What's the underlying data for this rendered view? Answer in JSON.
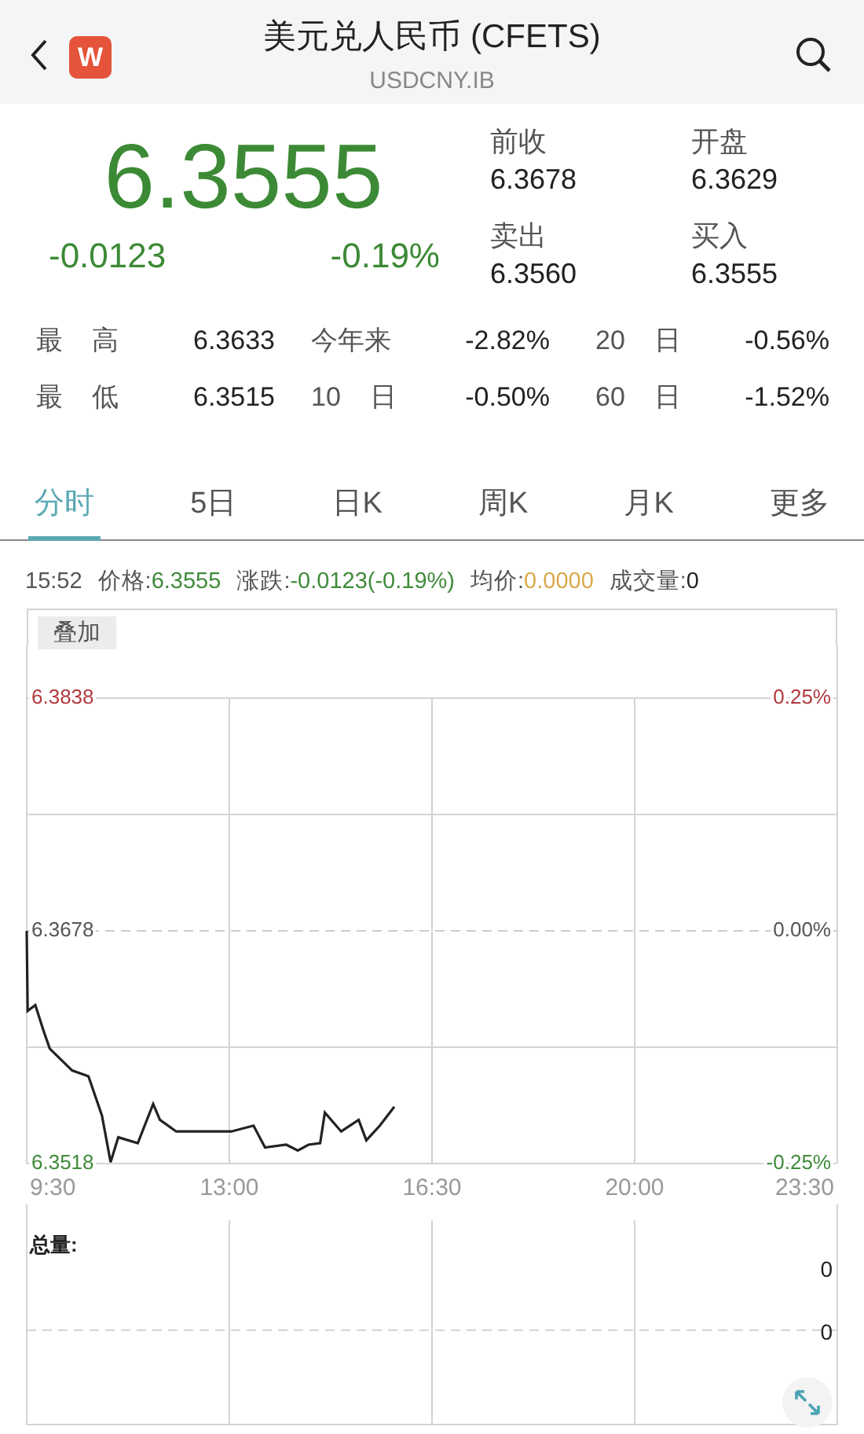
{
  "header": {
    "title": "美元兑人民币 (CFETS)",
    "subtitle": "USDCNY.IB",
    "logo_letter": "W"
  },
  "quote": {
    "price": "6.3555",
    "change": "-0.0123",
    "change_pct": "-0.19%",
    "fields": [
      {
        "label": "前收",
        "value": "6.3678"
      },
      {
        "label": "开盘",
        "value": "6.3629"
      },
      {
        "label": "卖出",
        "value": "6.3560"
      },
      {
        "label": "买入",
        "value": "6.3555"
      }
    ]
  },
  "stats": [
    [
      {
        "label": "最 高",
        "value": "6.3633"
      },
      {
        "label": "今年来",
        "value": "-2.82%"
      },
      {
        "label": "20 日",
        "value": "-0.56%"
      }
    ],
    [
      {
        "label": "最 低",
        "value": "6.3515"
      },
      {
        "label": "10 日",
        "value": "-0.50%"
      },
      {
        "label": "60 日",
        "value": "-1.52%"
      }
    ]
  ],
  "tabs": [
    {
      "label": "分时",
      "selected": true
    },
    {
      "label": "5日",
      "selected": false
    },
    {
      "label": "日K",
      "selected": false
    },
    {
      "label": "周K",
      "selected": false
    },
    {
      "label": "月K",
      "selected": false
    },
    {
      "label": "更多",
      "selected": false
    }
  ],
  "info": {
    "time": "15:52",
    "items": [
      {
        "label": "价格:",
        "value": "6.3555",
        "color": "#3f8b3a"
      },
      {
        "label": "涨跌:",
        "value": "-0.0123(-0.19%)",
        "color": "#3f8b3a"
      },
      {
        "label": "均价:",
        "value": "0.0000",
        "color": "#d9a84a"
      },
      {
        "label": "成交量:",
        "value": "0",
        "color": "#222222"
      }
    ]
  },
  "overlay_button": "叠加",
  "price_chart": {
    "chart_data": {
      "type": "line",
      "grid": true,
      "ref_lines": [
        {
          "axis": "y",
          "value": 6.3678
        }
      ],
      "xlim": [
        9.5,
        23.5
      ],
      "ylim": [
        6.3518,
        6.3838
      ],
      "xticks": [
        {
          "value": 9.5,
          "label": "9:30"
        },
        {
          "value": 13,
          "label": "13:00"
        },
        {
          "value": 16.5,
          "label": "16:30"
        },
        {
          "value": 20,
          "label": "20:00"
        },
        {
          "value": 23.5,
          "label": "23:30"
        }
      ],
      "yticks": [
        {
          "value": 6.3838,
          "label": "6.3838"
        },
        {
          "value": 6.3678,
          "label": "6.3678"
        },
        {
          "value": 6.3518,
          "label": "6.3518"
        }
      ],
      "x": [
        9.5,
        9.517,
        9.65,
        9.8,
        9.9,
        10.283,
        10.567,
        10.8,
        10.95,
        11.083,
        11.417,
        11.683,
        11.8,
        12.083,
        13.033,
        13.417,
        13.617,
        13.983,
        14.183,
        14.367,
        14.567,
        14.65,
        14.933,
        15.233,
        15.367,
        15.6,
        15.85
      ],
      "series": [
        {
          "color": "#222222",
          "values": [
            6.3678,
            6.3623,
            6.3627,
            6.3608,
            6.3597,
            6.3582,
            6.3578,
            6.3551,
            6.3519,
            6.3536,
            6.3532,
            6.3559,
            6.3548,
            6.354,
            6.354,
            6.3544,
            6.3529,
            6.3531,
            6.3527,
            6.3531,
            6.3532,
            6.3553,
            6.354,
            6.3548,
            6.3534,
            6.3544,
            6.3557
          ]
        }
      ]
    },
    "pct_labels": [
      {
        "label": "0.25%",
        "color": "#b23a3f"
      },
      {
        "label": "0.00%",
        "color": "#555555"
      },
      {
        "label": "-0.25%",
        "color": "#3f8b3a"
      }
    ]
  },
  "volume_chart": {
    "title": "总量:",
    "labels": [
      "0",
      "0"
    ]
  }
}
